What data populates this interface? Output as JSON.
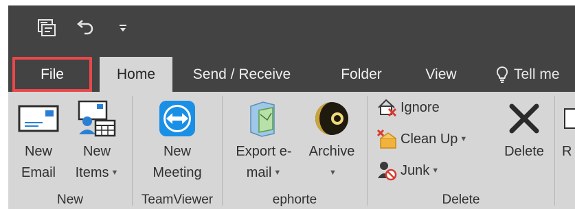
{
  "qat": {
    "icons": [
      "send-receive-all-folders-icon",
      "undo-icon",
      "customize-quick-access-icon"
    ]
  },
  "tabs": {
    "file": "File",
    "home": "Home",
    "send_receive": "Send / Receive",
    "folder": "Folder",
    "view": "View",
    "tell_me": "Tell me"
  },
  "ribbon": {
    "groups": {
      "new": "New",
      "teamviewer": "TeamViewer",
      "ephorte": "ephorte",
      "delete": "Delete"
    },
    "new_email": {
      "line1": "New",
      "line2": "Email"
    },
    "new_items": {
      "line1": "New",
      "line2": "Items"
    },
    "new_meeting": {
      "line1": "New",
      "line2": "Meeting"
    },
    "export_email": {
      "line1": "Export e-",
      "line2": "mail"
    },
    "archive": {
      "line1": "Archive"
    },
    "ignore": "Ignore",
    "clean_up": "Clean Up",
    "junk": "Junk",
    "delete": "Delete",
    "cut_off_label": "R"
  },
  "colors": {
    "titlebar": "#434343",
    "ribbon": "#d6d6d6",
    "highlight": "#e8484a",
    "teamviewer_blue": "#1a8fe6"
  }
}
